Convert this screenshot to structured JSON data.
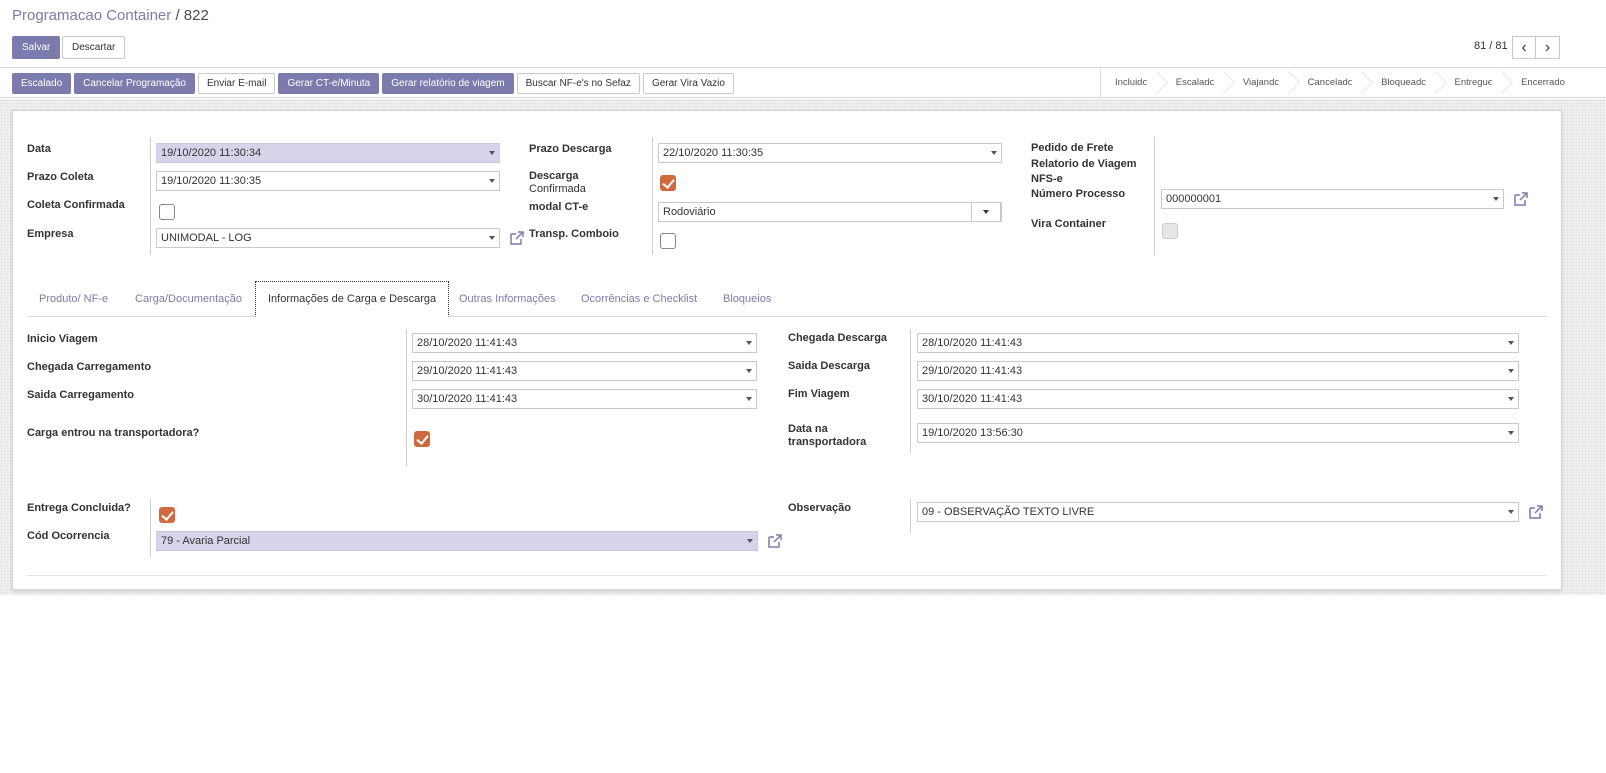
{
  "breadcrumb": {
    "parent": "Programacao Container",
    "separator": "/",
    "current": "822"
  },
  "actions": {
    "save": "Salvar",
    "discard": "Descartar"
  },
  "pager": {
    "value": "81 / 81",
    "prev": "‹",
    "next": "›"
  },
  "header_buttons": [
    {
      "label": "Escalado",
      "primary": true
    },
    {
      "label": "Cancelar Programação",
      "primary": true
    },
    {
      "label": "Enviar E-mail",
      "primary": false
    },
    {
      "label": "Gerar CT-e/Minuta",
      "primary": true
    },
    {
      "label": "Gerar relatório de viagem",
      "primary": true
    },
    {
      "label": "Buscar NF-e's no Sefaz",
      "primary": false
    },
    {
      "label": "Gerar Vira Vazio",
      "primary": false
    }
  ],
  "stages": [
    "Incluido",
    "Escalado",
    "Viajando",
    "Cancelado",
    "Bloqueado",
    "Entregue",
    "Encerrado"
  ],
  "top": {
    "data_label": "Data",
    "data_value": "19/10/2020 11:30:34",
    "prazo_coleta_label": "Prazo Coleta",
    "prazo_coleta_value": "19/10/2020 11:30:35",
    "coleta_confirmada_label": "Coleta Confirmada",
    "coleta_confirmada": false,
    "empresa_label": "Empresa",
    "empresa_value": "UNIMODAL - LOG",
    "prazo_descarga_label": "Prazo Descarga",
    "prazo_descarga_value": "22/10/2020 11:30:35",
    "descarga_confirmada_label_1": "Descarga",
    "descarga_confirmada_label_2": "Confirmada",
    "descarga_confirmada": true,
    "modal_cte_label": "modal CT-e",
    "modal_cte_value": "Rodoviário",
    "transp_comboio_label": "Transp. Comboio",
    "transp_comboio": false,
    "pedido_frete_label": "Pedido de Frete",
    "relatorio_viagem_label": "Relatorio de Viagem",
    "nfse_label": "NFS-e",
    "numero_processo_label": "Número Processo",
    "numero_processo_value": "000000001",
    "vira_container_label": "Vira Container",
    "vira_container": false
  },
  "tabs": [
    {
      "label": "Produto/ NF-e",
      "active": false
    },
    {
      "label": "Carga/Documentação",
      "active": false
    },
    {
      "label": "Informações de Carga e Descarga",
      "active": true
    },
    {
      "label": "Outras Informações",
      "active": false
    },
    {
      "label": "Ocorrências e Checklist",
      "active": false
    },
    {
      "label": "Bloqueios",
      "active": false
    }
  ],
  "carga": {
    "inicio_viagem_label": "Inicio Viagem",
    "inicio_viagem_value": "28/10/2020 11:41:43",
    "chegada_carregamento_label": "Chegada Carregamento",
    "chegada_carregamento_value": "29/10/2020 11:41:43",
    "saida_carregamento_label": "Saida Carregamento",
    "saida_carregamento_value": "30/10/2020 11:41:43",
    "carga_entrou_label": "Carga entrou na transportadora?",
    "carga_entrou": true,
    "chegada_descarga_label": "Chegada Descarga",
    "chegada_descarga_value": "28/10/2020 11:41:43",
    "saida_descarga_label": "Saida Descarga",
    "saida_descarga_value": "29/10/2020 11:41:43",
    "fim_viagem_label": "Fim Viagem",
    "fim_viagem_value": "30/10/2020 11:41:43",
    "data_transp_label_1": "Data na",
    "data_transp_label_2": "transportadora",
    "data_transp_value": "19/10/2020 13:56:30"
  },
  "entrega": {
    "entrega_concluida_label": "Entrega Concluida?",
    "entrega_concluida": true,
    "cod_ocorrencia_label": "Cód Ocorrencia",
    "cod_ocorrencia_value": "79 - Avaria Parcial",
    "observacao_label": "Observação",
    "observacao_value": "09 - OBSERVAÇÃO TEXTO LIVRE"
  },
  "colors": {
    "primary": "#7c7bad",
    "checkbox": "#cf6a3e",
    "readonly_field": "#d6d4eb"
  }
}
